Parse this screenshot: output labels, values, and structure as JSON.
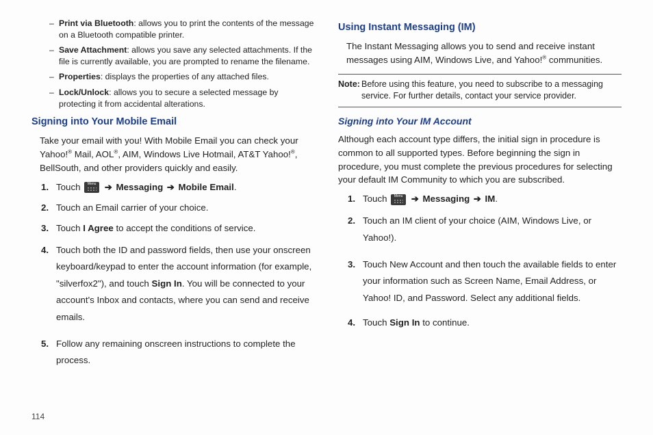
{
  "left": {
    "bullets": [
      {
        "term": "Print via Bluetooth",
        "desc": ": allows you to print the contents of the message on a Bluetooth compatible printer."
      },
      {
        "term": "Save Attachment",
        "desc": ": allows you save any selected attachments. If the file is currently available, you are prompted to rename the filename."
      },
      {
        "term": "Properties",
        "desc": ": displays the properties of any attached files."
      },
      {
        "term": "Lock/Unlock",
        "desc": ": allows you to secure a selected message by protecting it from accidental alterations."
      }
    ],
    "heading": "Signing into Your Mobile Email",
    "intro_a": "Take your email with you! With Mobile Email you can check your Yahoo!",
    "intro_b": " Mail, AOL",
    "intro_c": ", AIM, Windows Live Hotmail, AT&T Yahoo!",
    "intro_d": ", BellSouth, and other providers quickly and easily.",
    "steps": {
      "s1_a": "Touch ",
      "s1_b": "Messaging",
      "s1_c": "Mobile Email",
      "s2": "Touch an Email carrier of your choice.",
      "s3_a": "Touch ",
      "s3_b": "I Agree",
      "s3_c": " to accept the conditions of service.",
      "s4_a": "Touch both the ID and password fields, then use your onscreen keyboard/keypad to enter the account information (for example, \"silverfox2\"), and touch ",
      "s4_b": "Sign In",
      "s4_c": ". You will be connected to your account's Inbox and contacts, where you can send and receive emails.",
      "s5": "Follow any remaining onscreen instructions to complete the process."
    }
  },
  "right": {
    "heading": "Using Instant Messaging (IM)",
    "intro_a": "The Instant Messaging allows you to send and receive instant messages using AIM, Windows Live, and Yahoo!",
    "intro_b": " communities.",
    "note_label": "Note:",
    "note_body": " Before using this feature, you need to subscribe to a messaging service. For further details, contact your service provider.",
    "sub_heading": "Signing into Your IM Account",
    "sub_intro": "Although each account type differs, the initial sign in procedure is common to all supported types. Before beginning the sign in procedure, you must complete the previous procedures for selecting your default IM Community to which you are subscribed.",
    "steps": {
      "s1_a": "Touch ",
      "s1_b": "Messaging",
      "s1_c": "IM",
      "s2": "Touch an IM client of your choice (AIM, Windows Live, or Yahoo!).",
      "s3": "Touch New Account and then touch the available fields to enter your information such as Screen Name, Email Address, or Yahoo! ID, and Password. Select any additional fields.",
      "s4_a": "Touch ",
      "s4_b": "Sign In",
      "s4_c": " to continue."
    }
  },
  "sup": "®",
  "arrow": "➔",
  "page_number": "114"
}
